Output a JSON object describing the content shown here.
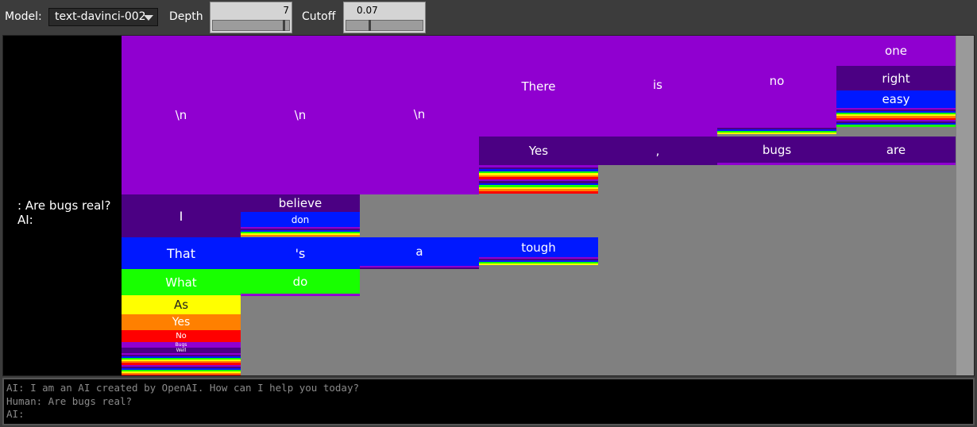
{
  "toolbar": {
    "model_label": "Model:",
    "model_value": "text-davinci-002",
    "depth_label": "Depth",
    "depth_value": "7",
    "depth_fraction": 0.95,
    "cutoff_label": "Cutoff",
    "cutoff_value": "0.07",
    "cutoff_fraction": 0.3
  },
  "prompt_text": ": Are bugs real?\nAI:",
  "tree": {
    "c0_r0": "\\n",
    "c0_r1": "I",
    "c0_r2": "That",
    "c0_r3": "What",
    "c0_r4": "As",
    "c0_r5": "Yes",
    "c0_r6": "No",
    "c0_r7": "Bugs",
    "c0_r8": "Well",
    "c1_r0": "\\n",
    "c1_r1": "believe",
    "c1_r2": "don",
    "c1_r3": "'s",
    "c1_r4": "do",
    "c2_r0": "\\n",
    "c2_r1": "a",
    "c3_r0": "There",
    "c3_r1": "Yes",
    "c3_r2": "tough",
    "c4_r0": "is",
    "c4_r1": ",",
    "c5_r0": "no",
    "c5_r1": "bugs",
    "c6_r0": "one",
    "c6_r1": "right",
    "c6_r2": "easy",
    "c6_r3": "are"
  },
  "colors": {
    "purple": "#9000d0",
    "dark_purple": "#4b0083",
    "blue": "#0018ff",
    "green": "#18ff00",
    "yellow": "#ffff00",
    "orange": "#ff8000",
    "red": "#ff0000",
    "background": "#808080"
  },
  "console": {
    "line1": "AI: I am an AI created by OpenAI. How can I help you today?",
    "line2": "Human: Are bugs real?",
    "line3": "AI:"
  }
}
